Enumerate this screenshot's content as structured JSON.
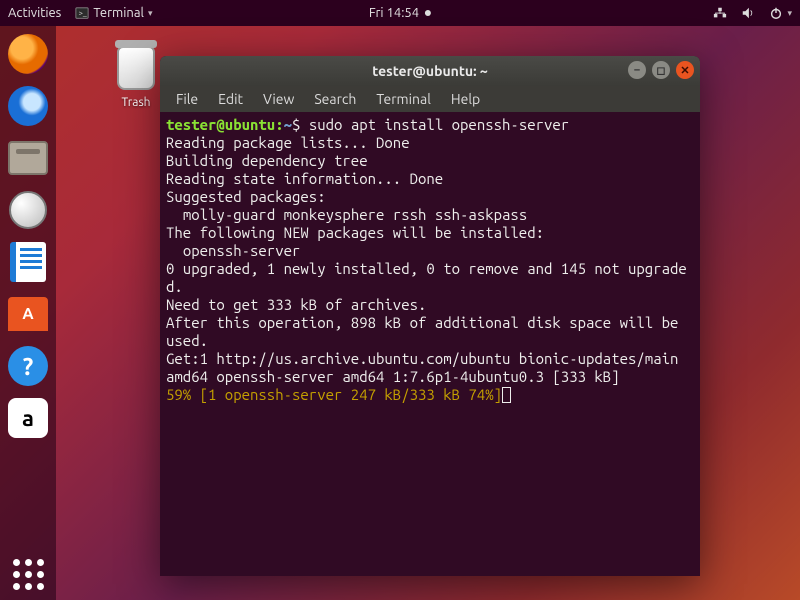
{
  "topbar": {
    "activities": "Activities",
    "app_indicator": "Terminal",
    "clock": "Fri 14:54"
  },
  "desktop": {
    "trash_label": "Trash"
  },
  "dock": {
    "firefox": "firefox",
    "thunderbird": "thunderbird",
    "files": "files",
    "rhythmbox": "rhythmbox",
    "writer": "libreoffice-writer",
    "software": "ubuntu-software",
    "help": "help",
    "amazon": "amazon",
    "apps": "show-applications"
  },
  "window": {
    "title": "tester@ubuntu: ~",
    "menus": [
      "File",
      "Edit",
      "View",
      "Search",
      "Terminal",
      "Help"
    ]
  },
  "terminal": {
    "prompt_user": "tester@ubuntu",
    "prompt_sep": ":",
    "prompt_path": "~",
    "prompt_end": "$ ",
    "command": "sudo apt install openssh-server",
    "lines": [
      "Reading package lists... Done",
      "Building dependency tree",
      "Reading state information... Done",
      "Suggested packages:",
      "  molly-guard monkeysphere rssh ssh-askpass",
      "The following NEW packages will be installed:",
      "  openssh-server",
      "0 upgraded, 1 newly installed, 0 to remove and 145 not upgraded.",
      "Need to get 333 kB of archives.",
      "After this operation, 898 kB of additional disk space will be used.",
      "Get:1 http://us.archive.ubuntu.com/ubuntu bionic-updates/main amd64 openssh-server amd64 1:7.6p1-4ubuntu0.3 [333 kB]"
    ],
    "progress": "59% [1 openssh-server 247 kB/333 kB 74%]"
  }
}
